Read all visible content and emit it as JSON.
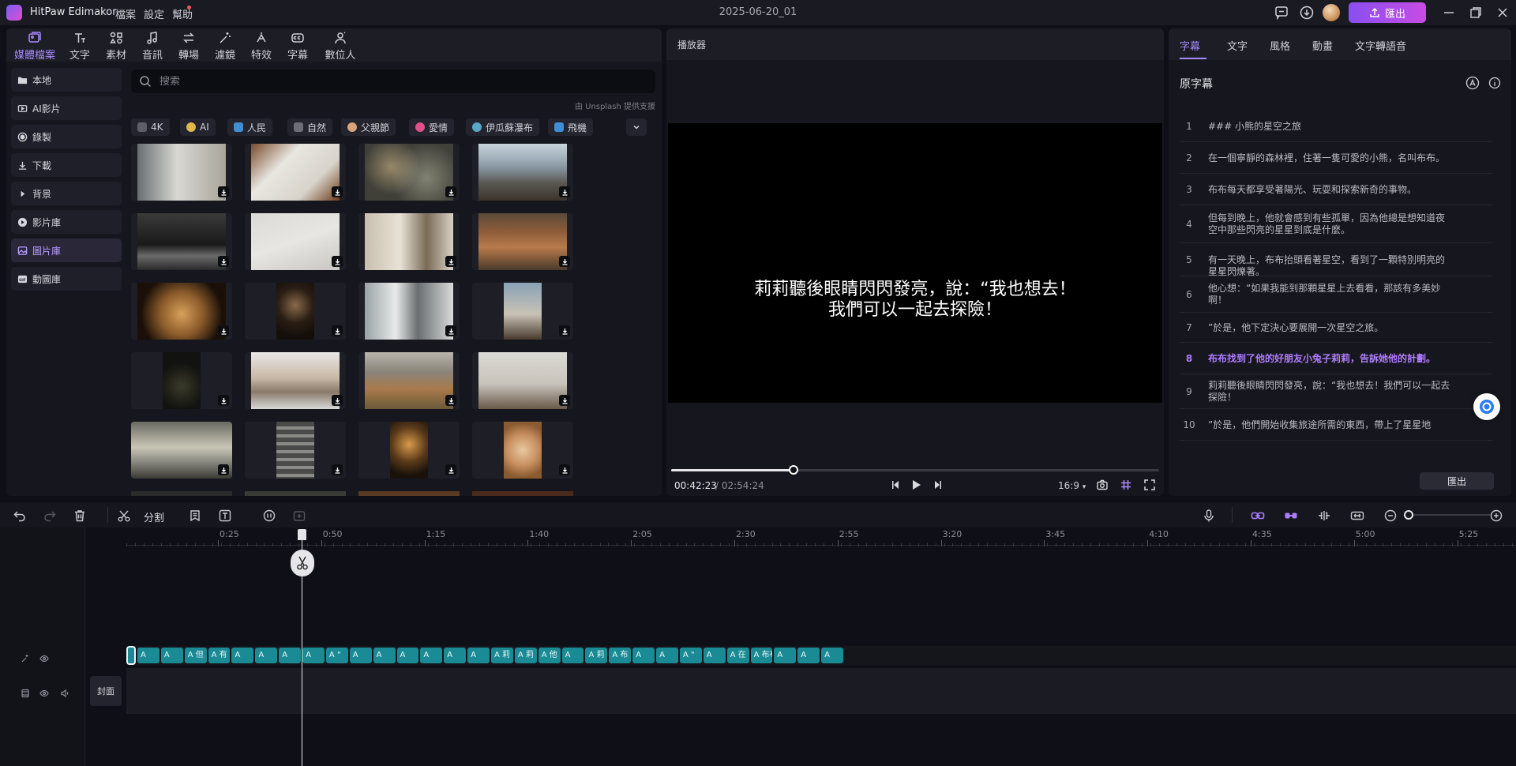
{
  "titlebar": {
    "app_name": "HitPaw Edimakor",
    "menu": [
      "檔案",
      "設定",
      "幫助"
    ],
    "project_title": "2025-06-20_01",
    "export_label": "匯出"
  },
  "media_tabs": [
    "媒體檔案",
    "文字",
    "素材",
    "音訊",
    "轉場",
    "濾鏡",
    "特效",
    "字幕",
    "數位人"
  ],
  "categories": [
    "本地",
    "AI影片",
    "錄製",
    "下載",
    "背景",
    "影片庫",
    "圖片庫",
    "動圖庫"
  ],
  "search": {
    "placeholder": "搜索"
  },
  "unsplash_note": "由 Unsplash 提供支援",
  "tags": [
    "4K",
    "AI",
    "人民",
    "自然",
    "父親節",
    "愛情",
    "伊瓜蘇瀑布",
    "飛機"
  ],
  "player": {
    "title": "播放器",
    "subtitle_line1": "莉莉聽後眼睛閃閃發亮，說：“我也想去！",
    "subtitle_line2": "我們可以一起去探險！",
    "time_current": "00:42:23",
    "time_total": "/ 02:54:24",
    "progress": 0.25,
    "ratio": "16:9"
  },
  "right_panel": {
    "tabs": [
      "字幕",
      "文字",
      "風格",
      "動畫",
      "文字轉語音"
    ],
    "heading": "原字幕",
    "export_label": "匯出",
    "subtitles": [
      {
        "n": "1",
        "text": "### 小熊的星空之旅"
      },
      {
        "n": "2",
        "text": "在一個寧靜的森林裡，住著一隻可愛的小熊，名叫布布。"
      },
      {
        "n": "3",
        "text": "布布每天都享受著陽光、玩耍和探索新奇的事物。"
      },
      {
        "n": "4",
        "text": "但每到晚上，他就會感到有些孤單，因為他總是想知道夜空中那些閃亮的星星到底是什麼。"
      },
      {
        "n": "5",
        "text": "有一天晚上，布布抬頭看著星空，看到了一顆特別明亮的星星閃爍著。"
      },
      {
        "n": "6",
        "text": "他心想：“如果我能到那顆星星上去看看，那該有多美妙啊！"
      },
      {
        "n": "7",
        "text": "”於是，他下定決心要展開一次星空之旅。"
      },
      {
        "n": "8",
        "text": "布布找到了他的好朋友小兔子莉莉，告訴她他的計劃。"
      },
      {
        "n": "9",
        "text": "莉莉聽後眼睛閃閃發亮，說：“我也想去！我們可以一起去探險！"
      },
      {
        "n": "10",
        "text": "”於是，他們開始收集旅途所需的東西，帶上了星星地"
      }
    ]
  },
  "timeline": {
    "split_label": "分割",
    "ticks": [
      "0:25",
      "0:50",
      "1:15",
      "1:40",
      "2:05",
      "2:30",
      "2:55",
      "3:20",
      "3:45",
      "4:10",
      "4:35",
      "5:00",
      "5:25"
    ],
    "cover_label": "封面",
    "clips": [
      "A",
      "A",
      "A 但",
      "A 有",
      "A",
      "A",
      "A",
      "A",
      "A \"",
      "A",
      "A",
      "A",
      "A",
      "A",
      "A",
      "A 莉",
      "A 莉",
      "A 他",
      "A",
      "A 莉",
      "A 布",
      "A",
      "A",
      "A \"",
      "A",
      "A 在",
      "A 布布",
      "A",
      "A",
      "A"
    ]
  },
  "colors": {
    "accent": "#a98bff",
    "clip": "#1a8a94",
    "export_gradient_start": "#8a4ff0",
    "export_gradient_end": "#c74ce4"
  }
}
